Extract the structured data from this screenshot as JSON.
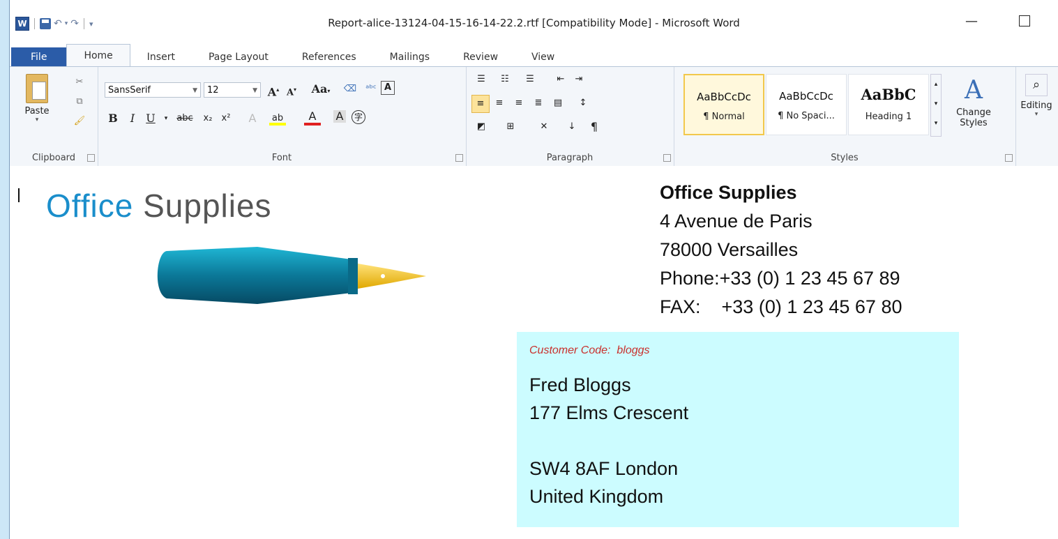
{
  "window": {
    "title": "Report-alice-13124-04-15-16-14-22.2.rtf [Compatibility Mode] - Microsoft Word",
    "word_logo": "W",
    "undo_icon": "undo-icon",
    "redo_icon": "redo-icon"
  },
  "tabs": [
    {
      "label": "File"
    },
    {
      "label": "Home"
    },
    {
      "label": "Insert"
    },
    {
      "label": "Page Layout"
    },
    {
      "label": "References"
    },
    {
      "label": "Mailings"
    },
    {
      "label": "Review"
    },
    {
      "label": "View"
    }
  ],
  "ribbon": {
    "clipboard": {
      "label": "Clipboard",
      "paste": "Paste"
    },
    "font": {
      "label": "Font",
      "family": "SansSerif",
      "size": "12",
      "aa_label": "Aa"
    },
    "paragraph": {
      "label": "Paragraph"
    },
    "styles": {
      "label": "Styles",
      "items": [
        {
          "sample": "AaBbCcDc",
          "name": "¶ Normal",
          "selected": true
        },
        {
          "sample": "AaBbCcDc",
          "name": "¶ No Spaci...",
          "selected": false
        },
        {
          "sample": "AaBbC",
          "name": "Heading 1",
          "selected": false
        }
      ],
      "change_styles": "Change Styles"
    },
    "editing": {
      "label": "Editing"
    }
  },
  "document": {
    "logo": {
      "word1": "Office",
      "word2": "Supplies"
    },
    "company": {
      "name": "Office Supplies",
      "street": "4 Avenue de Paris",
      "city": "78000 Versailles",
      "phone": "Phone:+33 (0) 1 23 45 67 89",
      "fax": "FAX:    +33 (0) 1 23 45 67 80"
    },
    "customer": {
      "code_label": "Customer Code:  bloggs",
      "name": "Fred Bloggs",
      "street": "177 Elms Crescent",
      "blank": "",
      "city": "SW4 8AF London",
      "country": "United Kingdom"
    }
  },
  "colors": {
    "brand_blue": "#1a8ecb",
    "file_tab": "#2b5ca8",
    "customer_box": "#ccfcff",
    "customer_code": "#c9302c"
  }
}
